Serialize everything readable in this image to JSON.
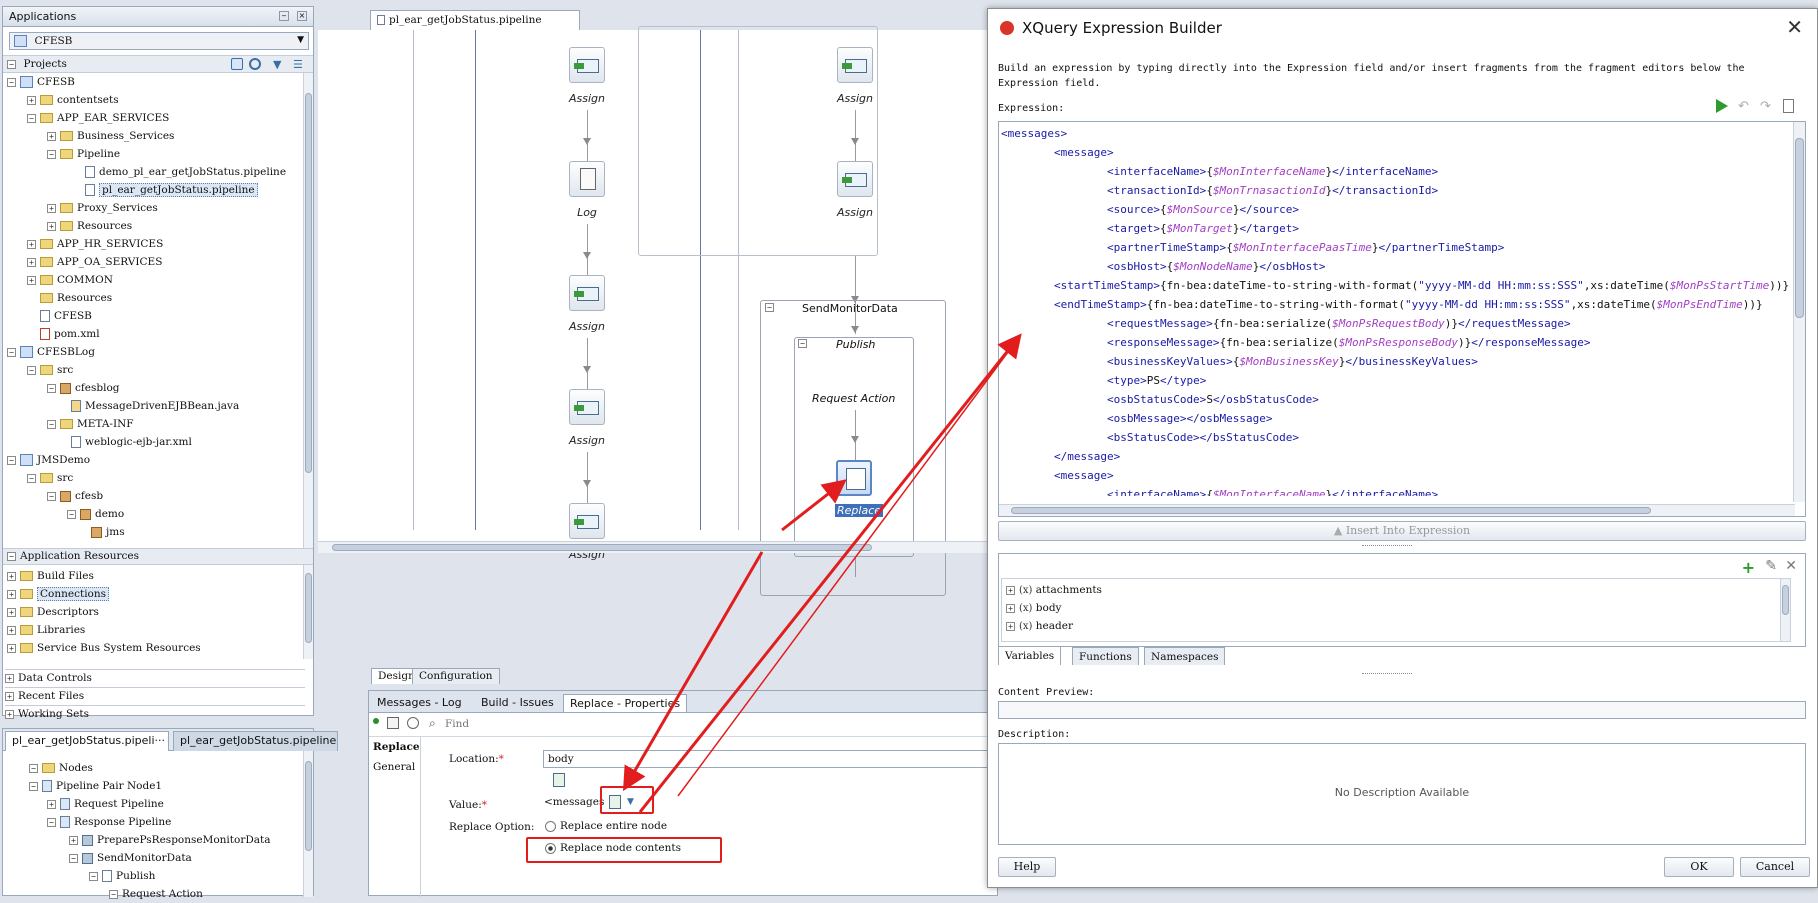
{
  "applications_panel": {
    "title": "Applications",
    "app_select": "CFESB",
    "projects_label": "Projects",
    "tree": [
      {
        "label": "CFESB"
      },
      {
        "label": "contentsets"
      },
      {
        "label": "APP_EAR_SERVICES"
      },
      {
        "label": "Business_Services"
      },
      {
        "label": "Pipeline"
      },
      {
        "label": "demo_pl_ear_getJobStatus.pipeline"
      },
      {
        "label": "pl_ear_getJobStatus.pipeline"
      },
      {
        "label": "Proxy_Services"
      },
      {
        "label": "Resources"
      },
      {
        "label": "APP_HR_SERVICES"
      },
      {
        "label": "APP_OA_SERVICES"
      },
      {
        "label": "COMMON"
      },
      {
        "label": "Resources"
      },
      {
        "label": "CFESB"
      },
      {
        "label": "pom.xml"
      },
      {
        "label": "CFESBLog"
      },
      {
        "label": "src"
      },
      {
        "label": "cfesblog"
      },
      {
        "label": "MessageDrivenEJBBean.java"
      },
      {
        "label": "META-INF"
      },
      {
        "label": "weblogic-ejb-jar.xml"
      },
      {
        "label": "JMSDemo"
      },
      {
        "label": "src"
      },
      {
        "label": "cfesb"
      },
      {
        "label": "demo"
      },
      {
        "label": "jms"
      }
    ],
    "app_resources_label": "Application Resources",
    "app_resources": [
      "Build Files",
      "Connections",
      "Descriptors",
      "Libraries",
      "Service Bus System Resources"
    ],
    "sections": [
      "Data Controls",
      "Recent Files",
      "Working Sets"
    ]
  },
  "structure_panel": {
    "tab1": "pl_ear_getJobStatus.pipeli···",
    "tab2": "pl_ear_getJobStatus.pipeline···",
    "tree": [
      "Nodes",
      "Pipeline Pair Node1",
      "Request Pipeline",
      "Response Pipeline",
      "PreparePsResponseMonitorData",
      "SendMonitorData",
      "Publish",
      "Request Action"
    ]
  },
  "editor": {
    "tab": "pl_ear_getJobStatus.pipeline",
    "left_nodes": [
      "Assign",
      "Log",
      "Assign",
      "Assign",
      "Assign"
    ],
    "right_nodes": [
      "Assign",
      "Assign"
    ],
    "stage_label": "SendMonitorData",
    "publish_label": "Publish",
    "request_action_label": "Request Action",
    "replace_label": "Replace",
    "bottom_tabs": [
      "Design",
      "Configuration"
    ]
  },
  "properties": {
    "tabs": [
      "Messages - Log",
      "Build - Issues",
      "Replace - Properties"
    ],
    "find_placeholder": "Find",
    "side_tabs": [
      "Replace",
      "General"
    ],
    "location_label": "Location:",
    "location_value": "body",
    "value_label": "Value:",
    "value_text": "<messages",
    "replace_option_label": "Replace Option:",
    "option1": "Replace entire node",
    "option2": "Replace node contents"
  },
  "dialog": {
    "title": "XQuery Expression Builder",
    "description": "Build an expression by typing directly into the Expression field and/or insert fragments from the fragment editors below the Expression field.",
    "expression_label": "Expression:",
    "insert_button": "Insert Into Expression",
    "variables": [
      "attachments",
      "body",
      "header"
    ],
    "tabs": [
      "Variables",
      "Functions",
      "Namespaces"
    ],
    "content_preview_label": "Content Preview:",
    "description_label": "Description:",
    "no_description": "No Description Available",
    "help": "Help",
    "ok": "OK",
    "cancel": "Cancel"
  },
  "colors": {
    "annotation_red": "#e21d1d",
    "xml_tag": "#1a1aa6",
    "xml_var": "#a23ec4"
  }
}
